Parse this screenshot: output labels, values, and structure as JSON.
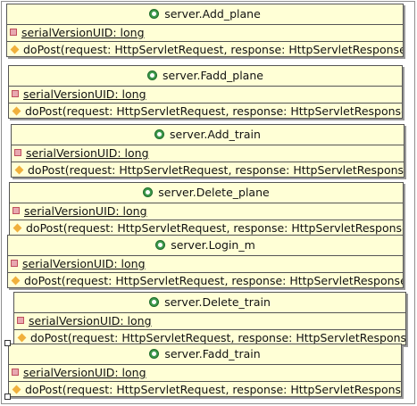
{
  "classes": [
    {
      "name": "server.Add_plane",
      "attribute": "serialVersionUID: long",
      "method": "doPost(request: HttpServletRequest, response: HttpServletResponse): void"
    },
    {
      "name": "server.Fadd_plane",
      "attribute": "serialVersionUID: long",
      "method": "doPost(request: HttpServletRequest, response: HttpServletResponse): void"
    },
    {
      "name": "server.Add_train",
      "attribute": "serialVersionUID: long",
      "method": "doPost(request: HttpServletRequest, response: HttpServletResponse): void"
    },
    {
      "name": "server.Delete_plane",
      "attribute": "serialVersionUID: long",
      "method": "doPost(request: HttpServletRequest, response: HttpServletResponse): void"
    },
    {
      "name": "server.Login_m",
      "attribute": "serialVersionUID: long",
      "method": "doPost(request: HttpServletRequest, response: HttpServletResponse): void"
    },
    {
      "name": "server.Delete_train",
      "attribute": "serialVersionUID: long",
      "method": "doPost(request: HttpServletRequest, response: HttpServletResponse): void"
    },
    {
      "name": "server.Fadd_train",
      "attribute": "serialVersionUID: long",
      "method": "doPost(request: HttpServletRequest, response: HttpServletResponse): void"
    }
  ],
  "colors": {
    "class_fill": "#ffffd6",
    "class_border": "#555555",
    "class_icon": "#3d9a4b",
    "field_icon": "#e8a8b0",
    "method_icon": "#f0b03c"
  }
}
